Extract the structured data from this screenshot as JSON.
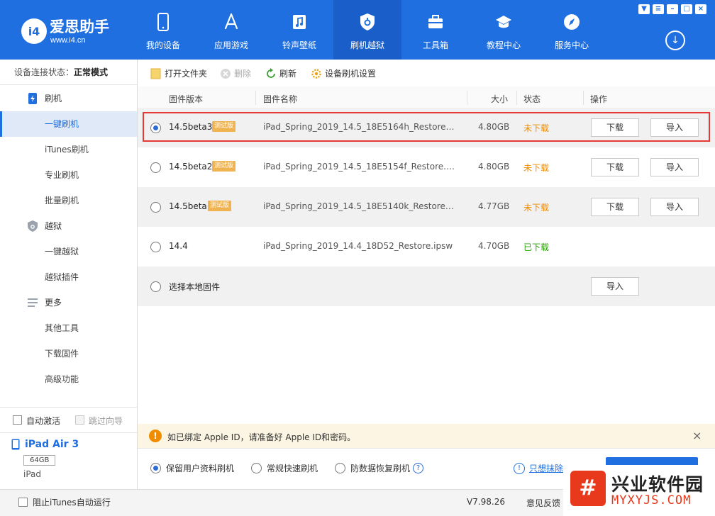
{
  "brand": {
    "logo_text": "i4",
    "name": "爱思助手",
    "url": "www.i4.cn"
  },
  "nav": {
    "items": [
      {
        "label": "我的设备",
        "icon": "phone-icon"
      },
      {
        "label": "应用游戏",
        "icon": "app-store-icon"
      },
      {
        "label": "铃声壁纸",
        "icon": "music-icon"
      },
      {
        "label": "刷机越狱",
        "icon": "shield-icon",
        "active": true
      },
      {
        "label": "工具箱",
        "icon": "toolbox-icon"
      },
      {
        "label": "教程中心",
        "icon": "graduation-cap-icon"
      },
      {
        "label": "服务中心",
        "icon": "compass-icon"
      }
    ],
    "download_icon": "↓"
  },
  "sidebar": {
    "status_label": "设备连接状态：",
    "status_value": "正常模式",
    "groups": [
      {
        "label": "刷机",
        "icon": "flash-phone-icon"
      },
      {
        "label": "越狱",
        "icon": "shield-icon"
      },
      {
        "label": "更多",
        "icon": "menu-icon"
      }
    ],
    "subs": [
      "一键刷机",
      "iTunes刷机",
      "专业刷机",
      "批量刷机",
      "一键越狱",
      "越狱插件",
      "其他工具",
      "下载固件",
      "高级功能"
    ],
    "auto_activate": "自动激活",
    "skip_guide": "跳过向导",
    "device": {
      "name": "iPad Air 3",
      "capacity": "64GB",
      "type": "iPad"
    }
  },
  "toolbar": {
    "open_folder": "打开文件夹",
    "delete": "删除",
    "refresh": "刷新",
    "settings": "设备刷机设置"
  },
  "table": {
    "headers": {
      "version": "固件版本",
      "name": "固件名称",
      "size": "大小",
      "status": "状态",
      "action": "操作"
    },
    "beta_badge": "测试版",
    "download_label": "下载",
    "import_label": "导入",
    "rows": [
      {
        "version": "14.5beta3",
        "beta": true,
        "name": "iPad_Spring_2019_14.5_18E5164h_Restore.ip...",
        "size": "4.80GB",
        "status": "未下载",
        "downloaded": false,
        "selected": true
      },
      {
        "version": "14.5beta2",
        "beta": true,
        "name": "iPad_Spring_2019_14.5_18E5154f_Restore.ipsw",
        "size": "4.80GB",
        "status": "未下载",
        "downloaded": false,
        "selected": false
      },
      {
        "version": "14.5beta",
        "beta": true,
        "name": "iPad_Spring_2019_14.5_18E5140k_Restore.ip...",
        "size": "4.77GB",
        "status": "未下载",
        "downloaded": false,
        "selected": false
      },
      {
        "version": "14.4",
        "beta": false,
        "name": "iPad_Spring_2019_14.4_18D52_Restore.ipsw",
        "size": "4.70GB",
        "status": "已下载",
        "downloaded": true,
        "selected": false
      }
    ],
    "local_firmware": "选择本地固件"
  },
  "notice": {
    "icon": "!",
    "text": "如已绑定 Apple ID，请准备好 Apple ID和密码。",
    "close": "×"
  },
  "options": {
    "keep_data": "保留用户资料刷机",
    "quick": "常规快速刷机",
    "anti_recovery": "防数据恢复刷机",
    "help": "?",
    "erase_link": "只想抹除"
  },
  "statusbar": {
    "block_itunes": "阻止iTunes自动运行",
    "version": "V7.98.26",
    "feedback": "意见反馈"
  },
  "watermark": {
    "cn": "兴业软件园",
    "en": "MYXYJS.COM"
  },
  "colors": {
    "primary": "#1f6fe0",
    "beta_badge": "#f0b351",
    "not_downloaded": "#f08c00",
    "downloaded": "#27a300",
    "highlight": "#e53935"
  }
}
